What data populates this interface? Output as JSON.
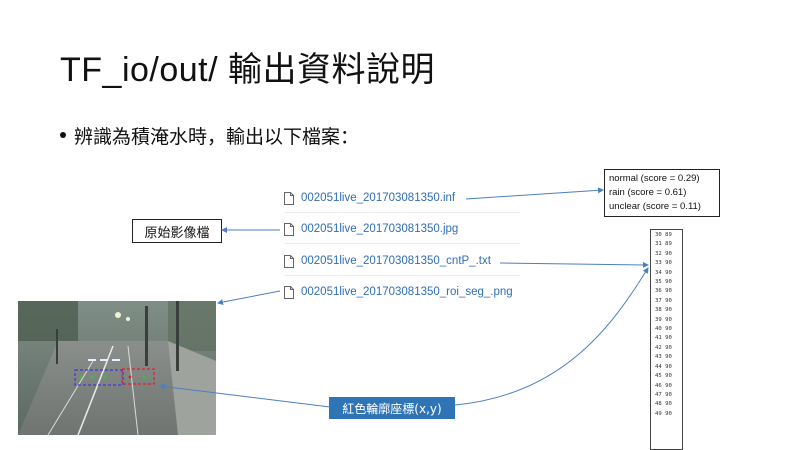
{
  "slide": {
    "title": "TF_io/out/ 輸出資料說明",
    "bullet": "辨識為積淹水時，輸出以下檔案："
  },
  "files": [
    {
      "name": "002051live_201703081350.inf",
      "icon": "file-icon"
    },
    {
      "name": "002051live_201703081350.jpg",
      "icon": "file-icon"
    },
    {
      "name": "002051live_201703081350_cntP_.txt",
      "icon": "file-icon"
    },
    {
      "name": "002051live_201703081350_roi_seg_.png",
      "icon": "file-icon"
    }
  ],
  "labels": {
    "original_image": "原始影像檔",
    "contour_coords": "紅色輪廓座標(x,y)"
  },
  "scores": [
    "normal (score = 0.29)",
    "rain (score = 0.61)",
    "unclear (score = 0.11)"
  ],
  "coordinates": [
    "30 89",
    "31 89",
    "32 90",
    "33 90",
    "34 90",
    "35 90",
    "36 90",
    "37 90",
    "38 90",
    "39 90",
    "40 90",
    "41 90",
    "42 90",
    "43 90",
    "44 90",
    "45 90",
    "46 90",
    "47 90",
    "48 90",
    "49 90"
  ],
  "colors": {
    "link_blue": "#2f6db3",
    "label_blue": "#2f75b6",
    "arrow_blue": "#4a7fc1",
    "contour_red": "#e0202a",
    "contour_blue": "#3b3bd6"
  }
}
